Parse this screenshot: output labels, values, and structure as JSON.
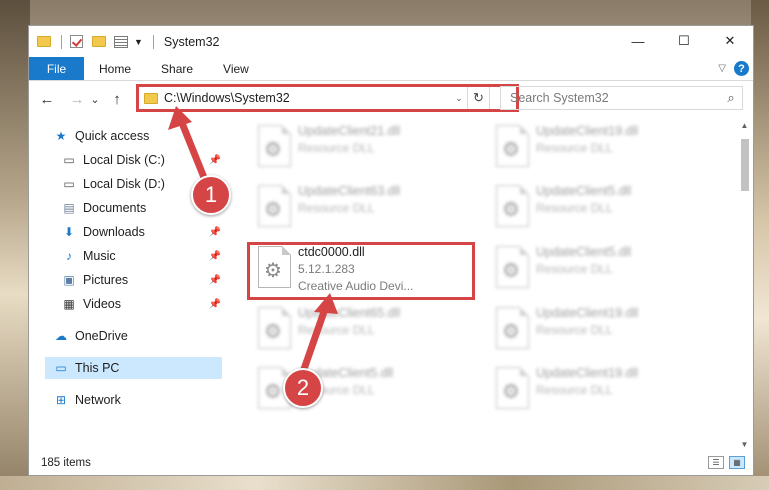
{
  "window": {
    "title": "System32",
    "controls": {
      "minimize": "—",
      "maximize": "☐",
      "close": "✕"
    }
  },
  "ribbon": {
    "tabs": [
      "File",
      "Home",
      "Share",
      "View"
    ]
  },
  "navigation": {
    "back": "←",
    "forward": "→",
    "recent": "⌄",
    "up": "↑",
    "address": "C:\\Windows\\System32",
    "search_placeholder": "Search System32"
  },
  "sidebar": {
    "quick_access": "Quick access",
    "items": [
      {
        "label": "Local Disk (C:)",
        "icon": "drive-icon",
        "pinned": true
      },
      {
        "label": "Local Disk (D:)",
        "icon": "drive-icon",
        "pinned": false
      },
      {
        "label": "Documents",
        "icon": "documents-icon",
        "pinned": true
      },
      {
        "label": "Downloads",
        "icon": "downloads-icon",
        "pinned": true
      },
      {
        "label": "Music",
        "icon": "music-icon",
        "pinned": true
      },
      {
        "label": "Pictures",
        "icon": "pictures-icon",
        "pinned": true
      },
      {
        "label": "Videos",
        "icon": "videos-icon",
        "pinned": true
      }
    ],
    "onedrive": "OneDrive",
    "this_pc": "This PC",
    "network": "Network"
  },
  "files": [
    {
      "name": "UpdateClient21.dll",
      "line2": "Resource DLL",
      "line3": "",
      "blurred": true
    },
    {
      "name": "UpdateClient19.dll",
      "line2": "Resource DLL",
      "line3": "",
      "blurred": true
    },
    {
      "name": "UpdateClient63.dll",
      "line2": "Resource DLL",
      "line3": "",
      "blurred": true
    },
    {
      "name": "UpdateClient5.dll",
      "line2": "Resource DLL",
      "line3": "",
      "blurred": true
    },
    {
      "name": "ctdc0000.dll",
      "line2": "5.12.1.283",
      "line3": "Creative Audio Devi...",
      "blurred": false
    },
    {
      "name": "UpdateClient5.dll",
      "line2": "Resource DLL",
      "line3": "",
      "blurred": true
    },
    {
      "name": "UpdateClient65.dll",
      "line2": "Resource DLL",
      "line3": "",
      "blurred": true
    },
    {
      "name": "UpdateClient19.dll",
      "line2": "Resource DLL",
      "line3": "",
      "blurred": true
    },
    {
      "name": "UpdateClient5.dll",
      "line2": "Resource DLL",
      "line3": "",
      "blurred": true
    },
    {
      "name": "UpdateClient19.dll",
      "line2": "Resource DLL",
      "line3": "",
      "blurred": true
    }
  ],
  "status": {
    "item_count": "185 items"
  },
  "annotations": {
    "step1": "1",
    "step2": "2",
    "color": "#d64545"
  }
}
